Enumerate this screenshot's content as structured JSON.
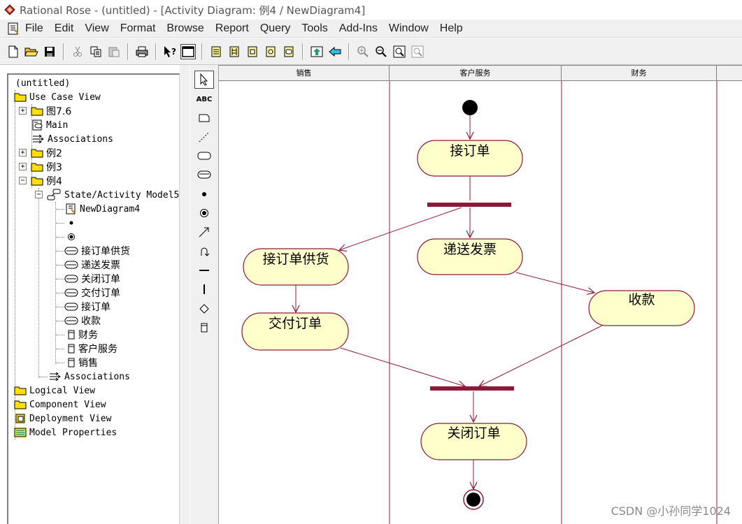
{
  "window": {
    "title": "Rational Rose - (untitled) - [Activity Diagram: 例4 / NewDiagram4]"
  },
  "menu": [
    "File",
    "Edit",
    "View",
    "Format",
    "Browse",
    "Report",
    "Query",
    "Tools",
    "Add-Ins",
    "Window",
    "Help"
  ],
  "toolbar": {
    "buttons": [
      "new-icon",
      "open-icon",
      "save-icon",
      "cut-icon",
      "copy-icon",
      "paste-icon",
      "print-icon",
      "context-help-icon",
      "view-doc-icon",
      "browse-class-icon",
      "browse-interaction-icon",
      "browse-component-icon",
      "browse-deployment-icon",
      "browse-state-icon",
      "browse-parent-icon",
      "browse-previous-icon",
      "zoom-in-icon",
      "zoom-out-icon",
      "fit-window-icon",
      "undo-fit-icon"
    ]
  },
  "tree": {
    "root": "(untitled)",
    "items": [
      {
        "label": "Use Case View"
      },
      {
        "label": "图7.6"
      },
      {
        "label": "Main"
      },
      {
        "label": "Associations"
      },
      {
        "label": "例2"
      },
      {
        "label": "例3"
      },
      {
        "label": "例4"
      },
      {
        "label": "State/Activity Model5"
      },
      {
        "label": "NewDiagram4"
      },
      {
        "label": "接订单供货"
      },
      {
        "label": "递送发票"
      },
      {
        "label": "关闭订单"
      },
      {
        "label": "交付订单"
      },
      {
        "label": "接订单"
      },
      {
        "label": "收款"
      },
      {
        "label": "财务"
      },
      {
        "label": "客户服务"
      },
      {
        "label": "销售"
      },
      {
        "label": "Associations"
      },
      {
        "label": "Logical View"
      },
      {
        "label": "Component View"
      },
      {
        "label": "Deployment View"
      },
      {
        "label": "Model Properties"
      }
    ]
  },
  "palette": {
    "tools": [
      "selection-arrow-icon",
      "text-box-icon",
      "note-icon",
      "anchor-note-icon",
      "state-icon",
      "activity-icon",
      "start-state-icon",
      "end-state-icon",
      "state-transition-icon",
      "transition-to-self-icon",
      "horizontal-sync-icon",
      "vertical-sync-icon",
      "decision-icon",
      "swimlane-icon"
    ],
    "text_label": "ABC"
  },
  "diagram": {
    "swimlanes": [
      "销售",
      "客户服务",
      "财务"
    ],
    "activities": {
      "receive_order": "接订单",
      "supply_order": "接订单供货",
      "send_invoice": "递送发票",
      "collect_payment": "收款",
      "deliver_order": "交付订单",
      "close_order": "关闭订单"
    },
    "colors": {
      "activity_fill": "#ffffcc",
      "line": "#8b1a3a",
      "sync_bar": "#8b1a3a"
    }
  },
  "watermark": "CSDN @小孙同学1024"
}
